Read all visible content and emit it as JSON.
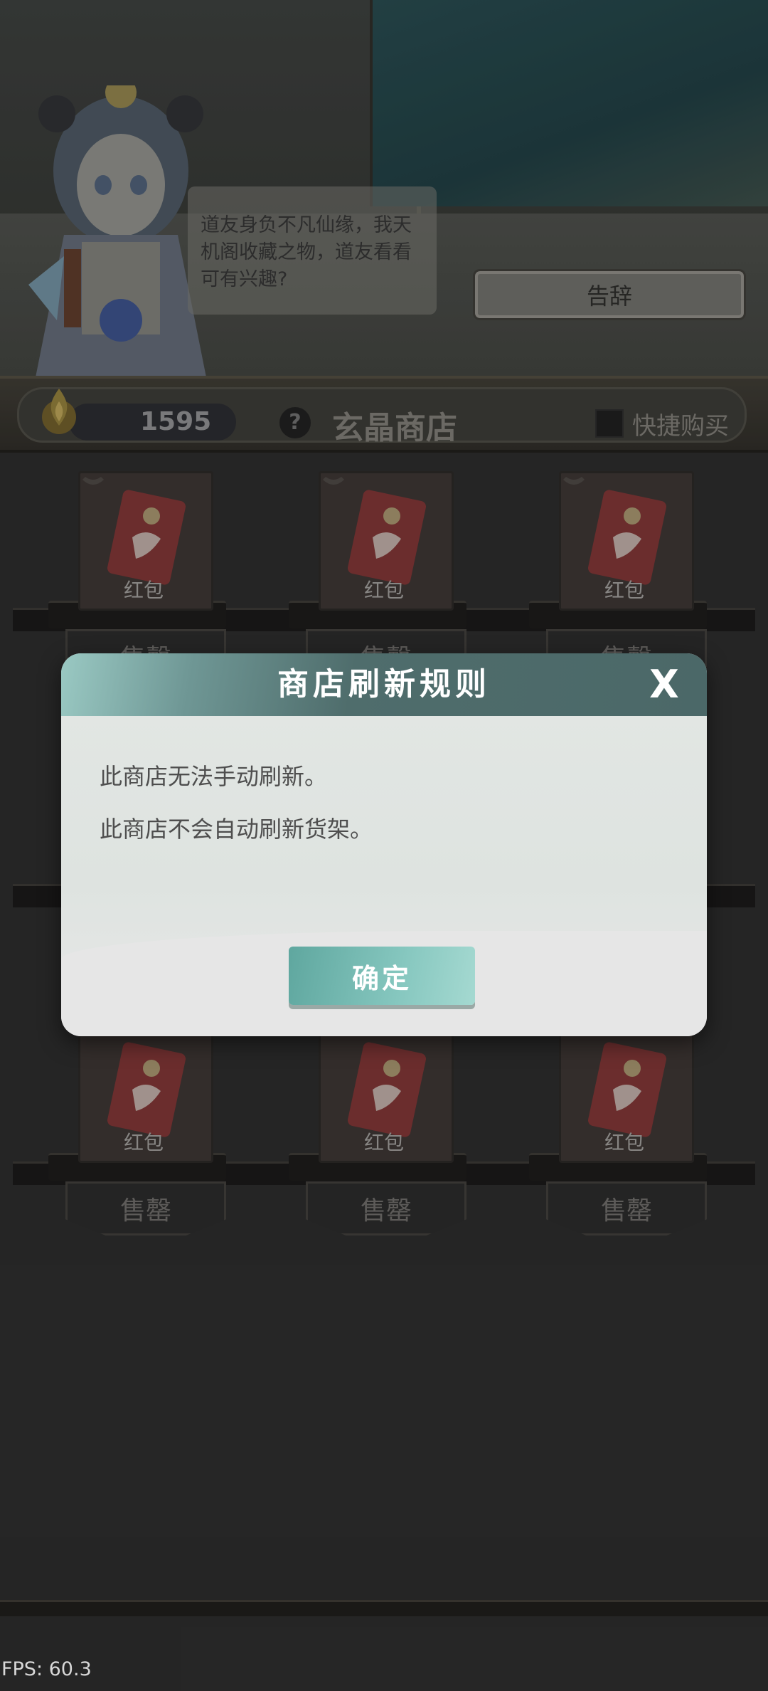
{
  "dialog": {
    "npc_speech": "道友身负不凡仙缘，我天机阁收藏之物，道友看看可有兴趣?",
    "farewell_button": "告辞"
  },
  "shop": {
    "currency_value": "1595",
    "help_label": "?",
    "title": "玄晶商店",
    "quick_buy_label": "快捷购买",
    "quick_buy_checked": false
  },
  "items": [
    {
      "name": "红包",
      "status": "售罄"
    },
    {
      "name": "红包",
      "status": "售罄"
    },
    {
      "name": "红包",
      "status": "售罄"
    },
    {
      "name": "红包",
      "status": "售罄"
    },
    {
      "name": "红包",
      "status": "售罄"
    },
    {
      "name": "红包",
      "status": "售罄"
    }
  ],
  "modal": {
    "title": "商店刷新规则",
    "close_label": "X",
    "lines": [
      "此商店无法手动刷新。",
      "此商店不会自动刷新货架。"
    ],
    "confirm_label": "确定"
  },
  "footer": {
    "fps": "FPS: 60.3"
  },
  "colors": {
    "modal_header": "#4f6d6c",
    "confirm_button": "#86c7bf",
    "envelope_red": "#a84848"
  }
}
